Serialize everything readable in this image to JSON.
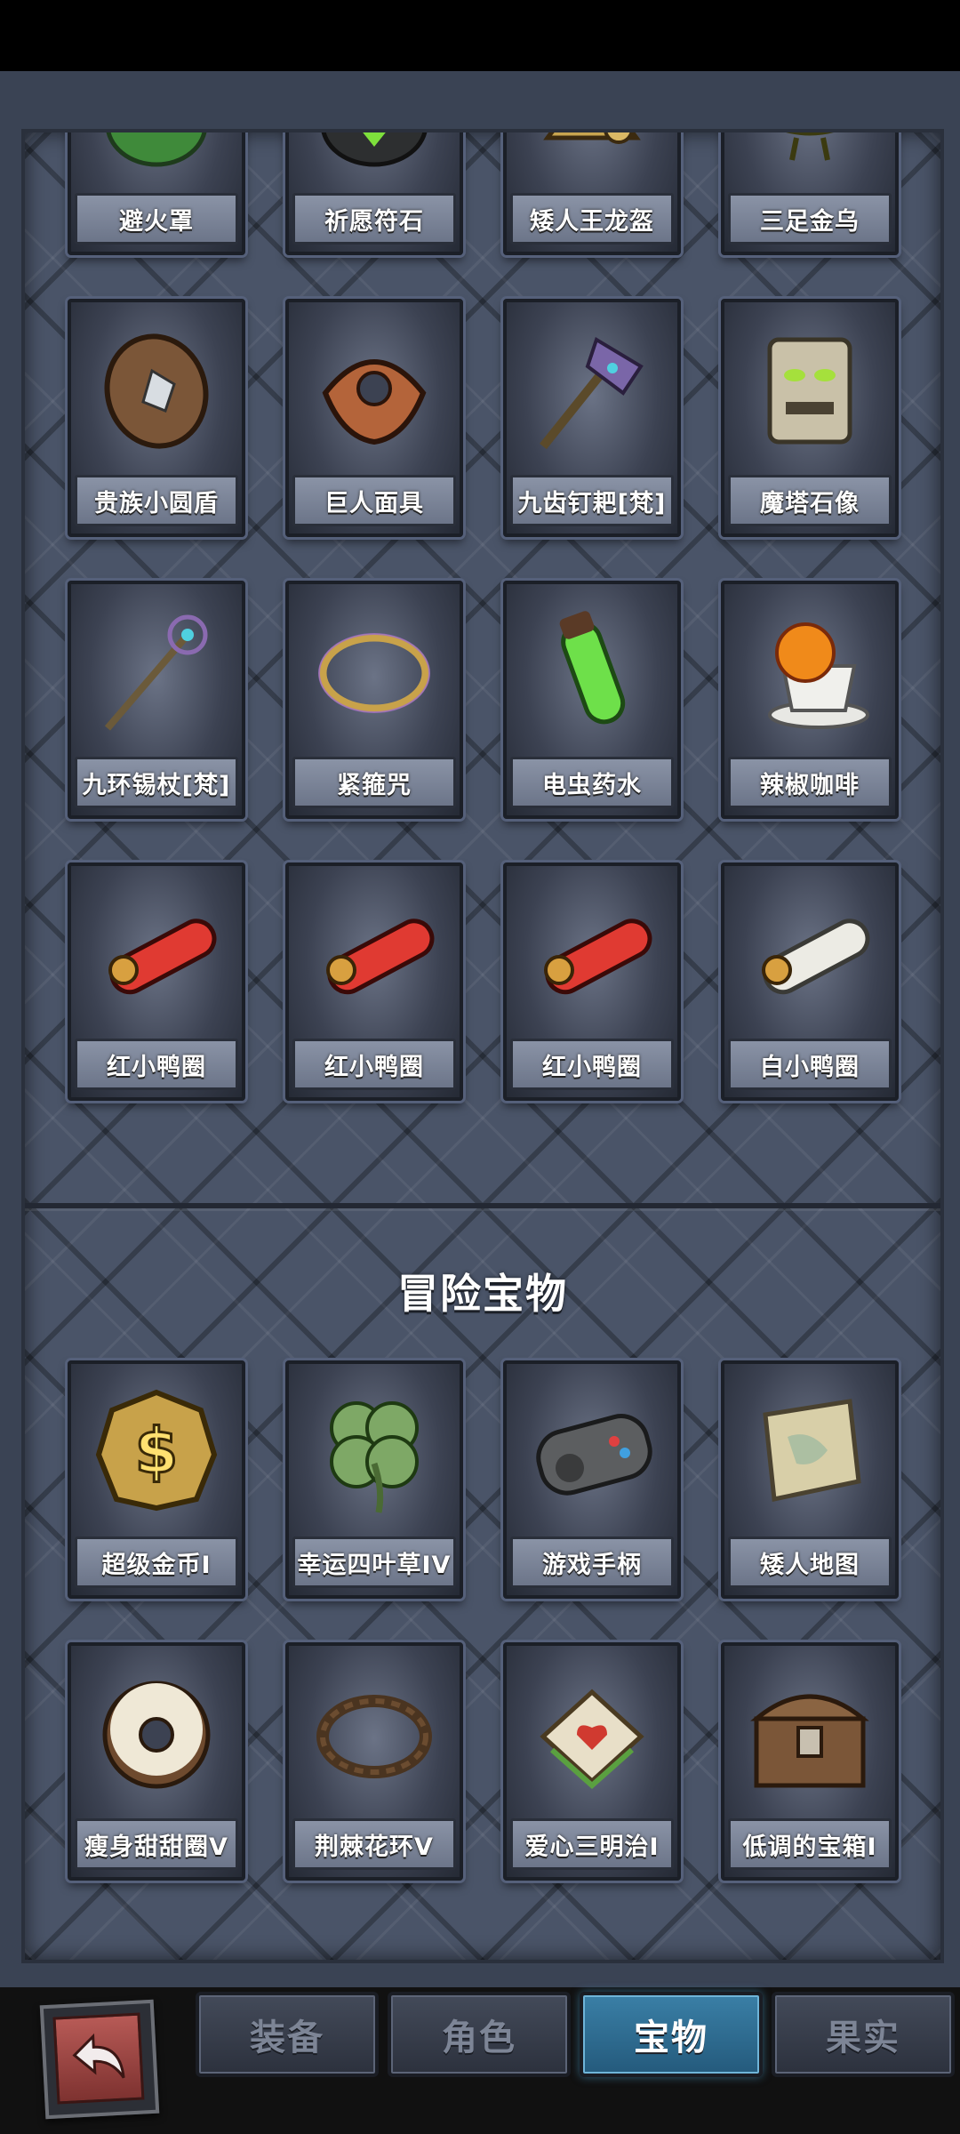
{
  "rows_top": [
    [
      "避火罩",
      "祈愿符石",
      "矮人王龙盔",
      "三足金乌"
    ],
    [
      "贵族小圆盾",
      "巨人面具",
      "九齿钉耙[梵]",
      "魔塔石像"
    ],
    [
      "九环锡杖[梵]",
      "紧箍咒",
      "电虫药水",
      "辣椒咖啡"
    ],
    [
      "红小鸭圈",
      "红小鸭圈",
      "红小鸭圈",
      "白小鸭圈"
    ]
  ],
  "section_title": "冒险宝物",
  "rows_bottom": [
    [
      "超级金币I",
      "幸运四叶草IV",
      "游戏手柄",
      "矮人地图"
    ],
    [
      "瘦身甜甜圈V",
      "荆棘花环V",
      "爱心三明治I",
      "低调的宝箱I"
    ]
  ],
  "tabs": {
    "equipment": "装备",
    "character": "角色",
    "treasure": "宝物",
    "fruit": "果实"
  },
  "icons": {
    "back": "back-arrow-icon"
  },
  "colors": {
    "active_tab": "#2f7aa6",
    "panel": "#4a5468",
    "back_button": "#a44a46"
  }
}
